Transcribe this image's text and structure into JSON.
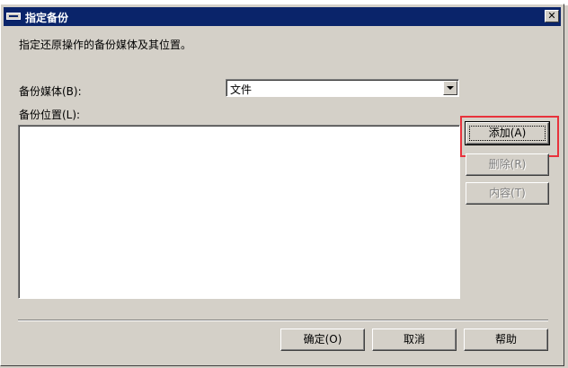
{
  "dialog": {
    "title": "指定备份",
    "close_glyph": "✕",
    "instruction": "指定还原操作的备份媒体及其位置。"
  },
  "media": {
    "label": "备份媒体(B):",
    "selected": "文件"
  },
  "location": {
    "label": "备份位置(L):",
    "items": []
  },
  "side_buttons": {
    "add": "添加(A)",
    "remove": "删除(R)",
    "contents": "内容(T)"
  },
  "footer_buttons": {
    "ok": "确定(O)",
    "cancel": "取消",
    "help": "帮助"
  },
  "colors": {
    "titlebar": "#0a246a",
    "face": "#d4d0c8",
    "highlight": "#e8323c"
  }
}
